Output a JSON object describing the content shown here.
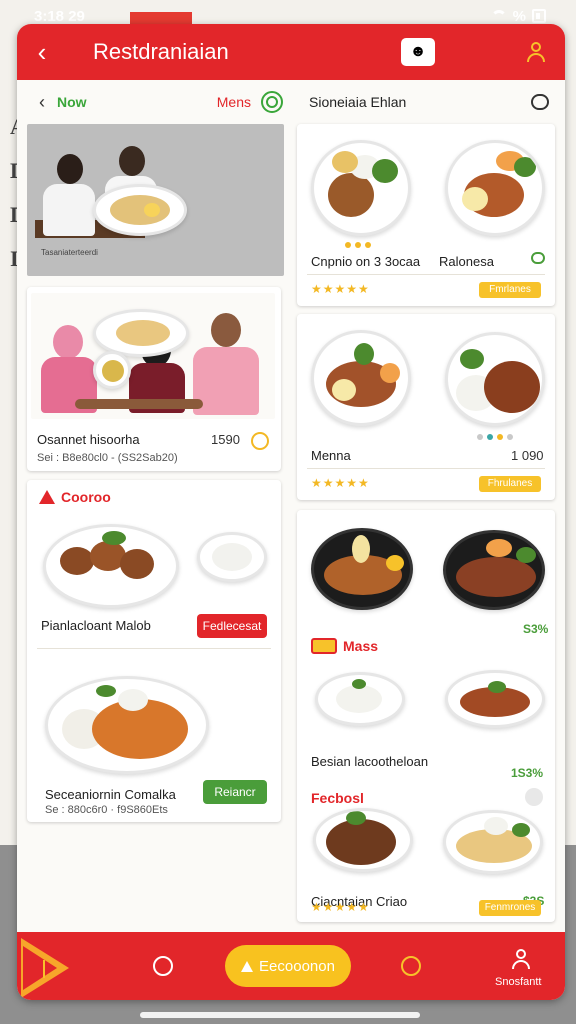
{
  "status_bar": {
    "time": "3:18 29",
    "signal": "%"
  },
  "background": {
    "letters": [
      "A",
      "D",
      "D",
      "I"
    ]
  },
  "app_bar": {
    "title": "Restdraniaian"
  },
  "left_panel": {
    "header": {
      "now_label": "Now",
      "menus_label": "Mens"
    },
    "hero_caption": "Tasaniaterteerdi",
    "family_card": {
      "name": "Osannet hisoorha",
      "meta": "Sei : B8e80cl0 - (SS2Sab20)",
      "price": "1590"
    },
    "combo_section": {
      "title": "Cooroo",
      "item1_name": "Pianlacloant Malob",
      "item1_button": "Fedlecesat",
      "item2_name": "Seceaniornin Comalka",
      "item2_meta": "Se : 880c6r0 · f9S860Ets",
      "item2_button": "Reiancr"
    }
  },
  "right_panel": {
    "header_label": "Sioneiaia Ehlan",
    "card1": {
      "item_left": "Cnpnio on 3 3ocaa",
      "item_right": "Ralonesa",
      "rating": "★★★★★",
      "button": "Fmrlanes"
    },
    "card2": {
      "item": "Menna",
      "price": "1 090",
      "rating": "★★★★★",
      "button": "Fhrulanes"
    },
    "card3": {
      "price1": "S3%",
      "section1": "Mass",
      "item2": "Besian lacootheloan",
      "price2": "1S3%",
      "section2": "Fecbosl",
      "item3": "Ciacntaian Criao",
      "price3": "$3S",
      "rating": "★★★★★",
      "button": "Fenmrones"
    }
  },
  "bottom_bar": {
    "cta_label": "Eecooonon",
    "profile_label": "Snosfantt"
  }
}
